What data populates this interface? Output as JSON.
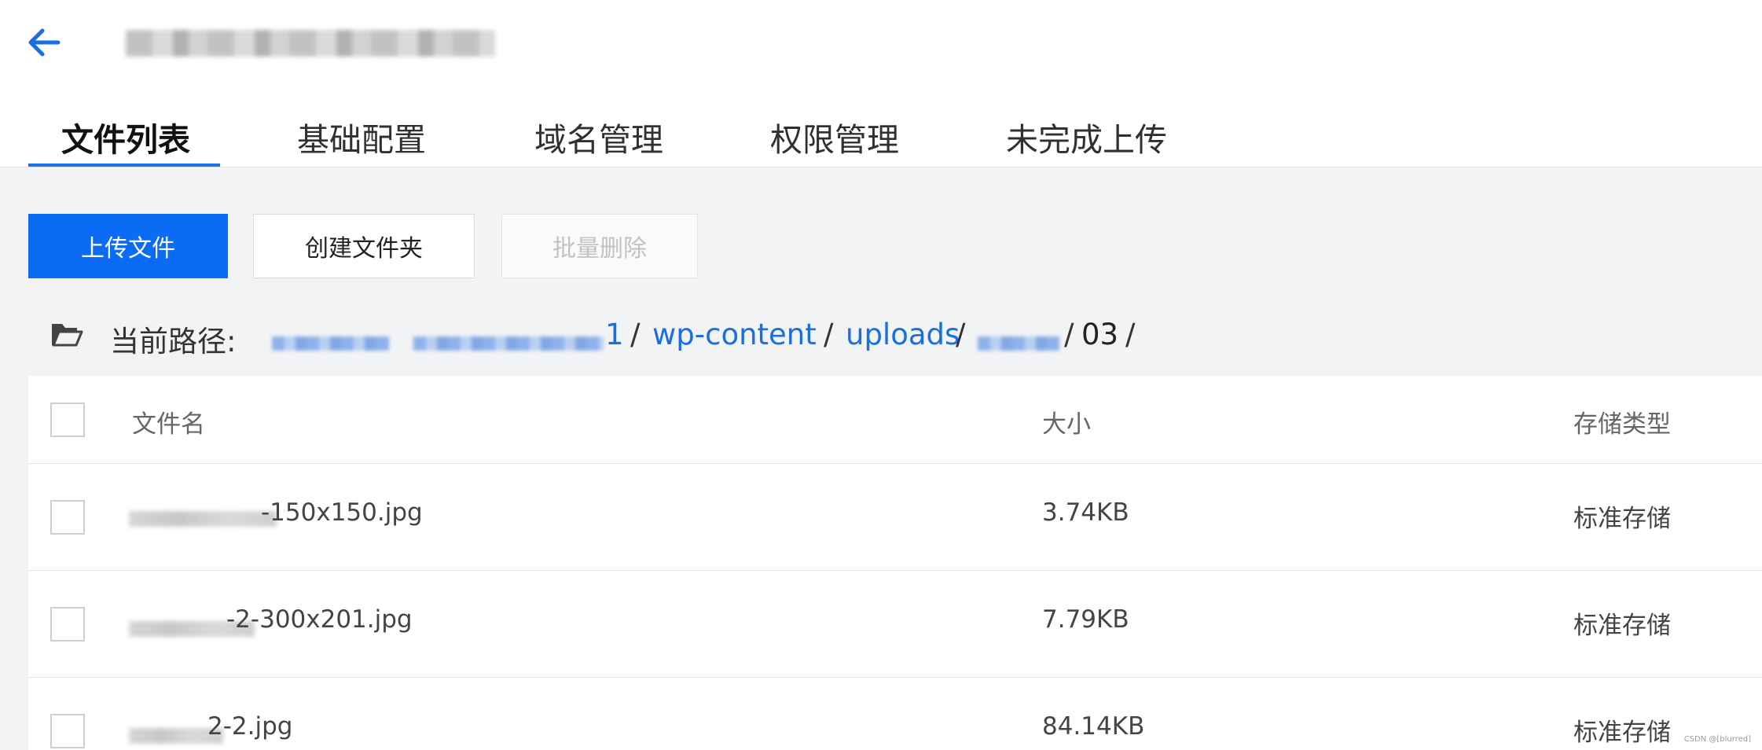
{
  "tabs": [
    "文件列表",
    "基础配置",
    "域名管理",
    "权限管理",
    "未完成上传"
  ],
  "toolbar": {
    "upload_label": "上传文件",
    "create_folder_label": "创建文件夹",
    "batch_delete_label": "批量删除"
  },
  "path": {
    "label": "当前路径:",
    "bucket_tail": "1",
    "seg_wp_content": "wp-content",
    "seg_uploads": "uploads",
    "seg_current": "03",
    "separator": "/"
  },
  "table": {
    "headers": {
      "name": "文件名",
      "size": "大小",
      "storage": "存储类型"
    },
    "rows": [
      {
        "name_suffix": "-150x150.jpg",
        "size": "3.74KB",
        "storage": "标准存储"
      },
      {
        "name_suffix": "-2-300x201.jpg",
        "size": "7.79KB",
        "storage": "标准存储"
      },
      {
        "name_suffix": "2-2.jpg",
        "size": "84.14KB",
        "storage": "标准存储"
      }
    ]
  },
  "watermark": "CSDN @[blurred]",
  "colors": {
    "accent": "#0a6cf5",
    "link": "#1a6fe0",
    "background": "#f2f3f5"
  }
}
